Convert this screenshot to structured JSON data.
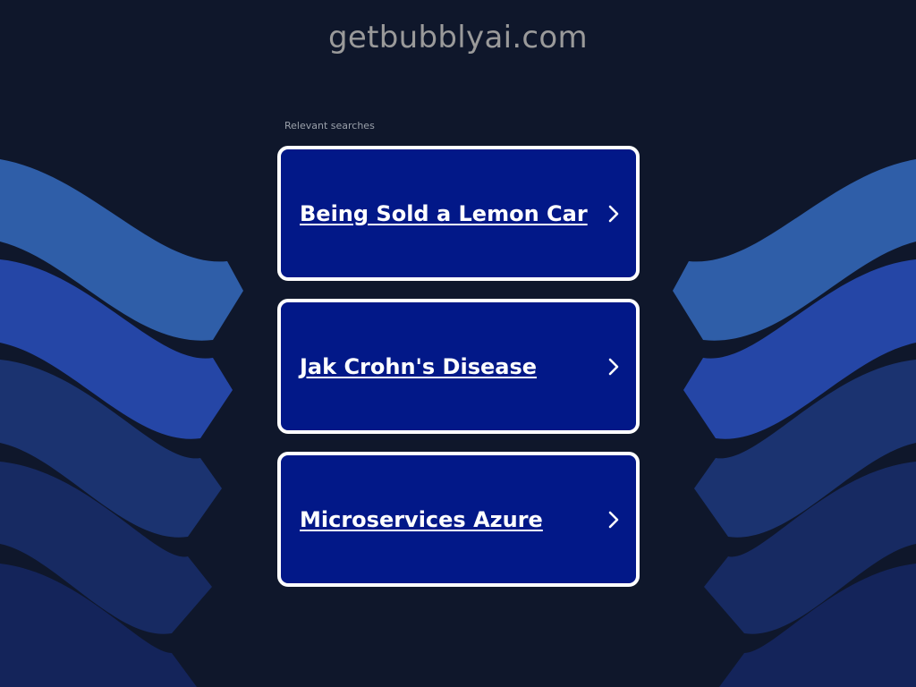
{
  "page": {
    "domain": "getbubblyai.com",
    "related_label": "Relevant searches"
  },
  "searches": [
    {
      "label": "Being Sold a Lemon Car",
      "icon": "chevron-right-icon"
    },
    {
      "label": "Jak Crohn's Disease",
      "icon": "chevron-right-icon"
    },
    {
      "label": "Microservices Azure",
      "icon": "chevron-right-icon"
    }
  ],
  "colors": {
    "background": "#0f172b",
    "card_fill": "#021888",
    "card_border": "#ffffff",
    "wave_1": "#2f5ea8",
    "wave_2": "#2546a6",
    "wave_3": "#1b3370",
    "wave_4": "#172a62",
    "wave_5": "#14245a"
  }
}
